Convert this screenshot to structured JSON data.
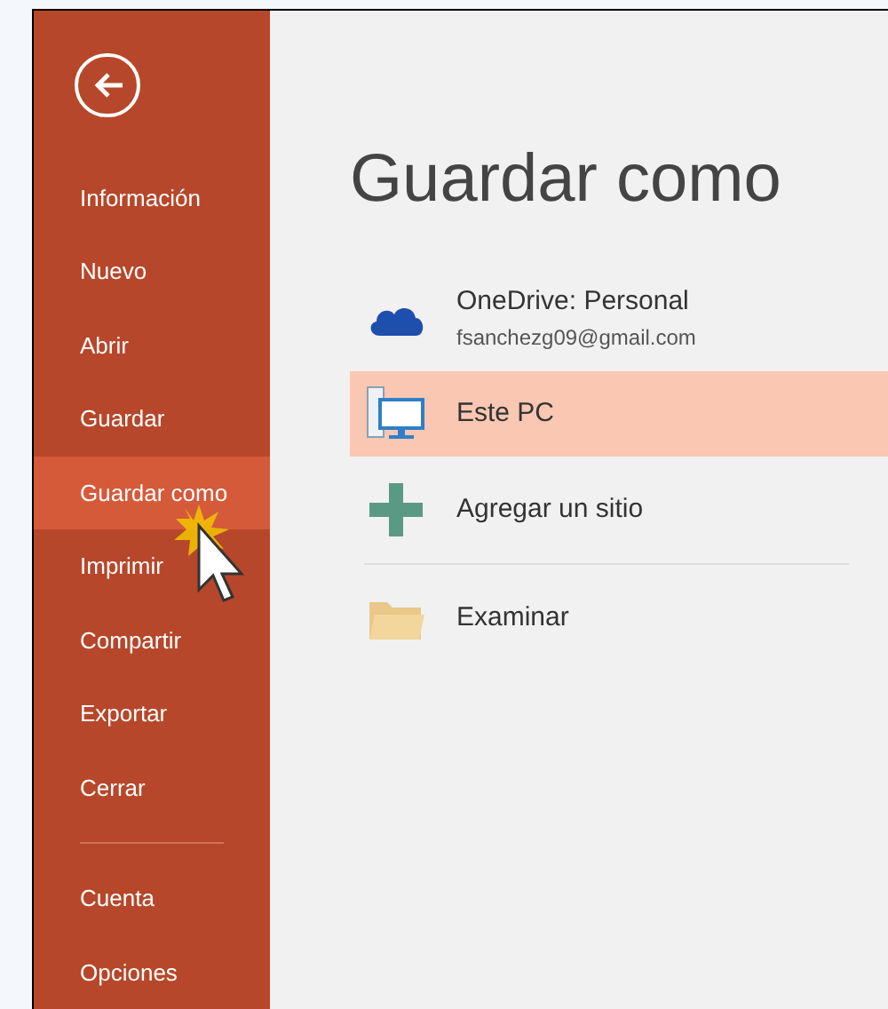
{
  "sidebar": {
    "items": [
      {
        "label": "Información",
        "selected": false
      },
      {
        "label": "Nuevo",
        "selected": false
      },
      {
        "label": "Abrir",
        "selected": false
      },
      {
        "label": "Guardar",
        "selected": false
      },
      {
        "label": "Guardar como",
        "selected": true
      },
      {
        "label": "Imprimir",
        "selected": false
      },
      {
        "label": "Compartir",
        "selected": false
      },
      {
        "label": "Exportar",
        "selected": false
      },
      {
        "label": "Cerrar",
        "selected": false
      }
    ],
    "bottom_items": [
      {
        "label": "Cuenta",
        "selected": false
      },
      {
        "label": "Opciones",
        "selected": false
      }
    ]
  },
  "title": "Guardar como",
  "places": [
    {
      "kind": "onedrive",
      "label": "OneDrive: Personal",
      "detail": "fsanchezg09@gmail.com",
      "selected": false
    },
    {
      "kind": "pc",
      "label": "Este PC",
      "selected": true
    },
    {
      "kind": "add",
      "label": "Agregar un sitio",
      "selected": false
    },
    {
      "kind": "browse",
      "label": "Examinar",
      "selected": false
    }
  ]
}
